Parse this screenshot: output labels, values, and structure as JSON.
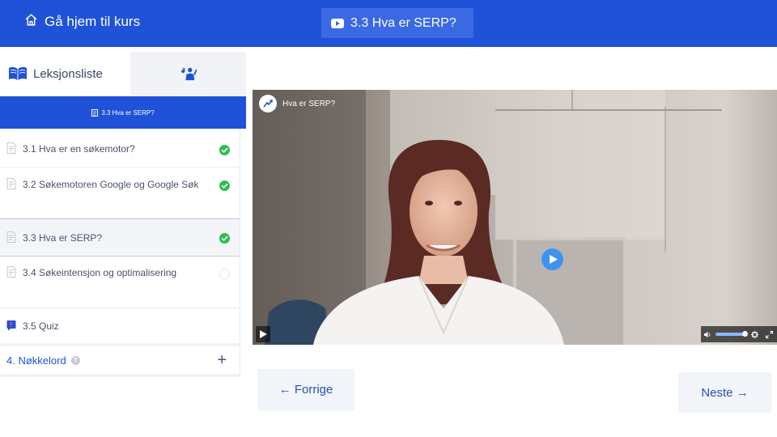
{
  "header": {
    "home_label": "Gå hjem til kurs",
    "home_icon": "home-icon",
    "current_lesson": "3.3 Hva er SERP?",
    "lesson_icon": "youtube-icon",
    "background": "#1f52d8"
  },
  "sidebar": {
    "tabs": [
      {
        "label": "Leksjonsliste",
        "icon": "book-open-icon"
      },
      {
        "label": "",
        "icon": "raised-hand-person-icon"
      }
    ],
    "current_label": "3.3 Hva er SERP?",
    "lessons": [
      {
        "title": "3.1 Hva er en søkemotor?",
        "icon": "document-icon",
        "status": "done"
      },
      {
        "title": "3.2 Søkemotoren Google og Google Søk",
        "icon": "document-icon",
        "status": "done"
      },
      {
        "title": "3.3 Hva er SERP?",
        "icon": "document-icon",
        "status": "done",
        "current": true
      },
      {
        "title": "3.4 Søkeintensjon og optimalisering",
        "icon": "document-icon",
        "status": "pending"
      },
      {
        "title": "3.5 Quiz",
        "icon": "quiz-icon",
        "status": "none"
      }
    ],
    "section": {
      "title": "4. Nøkkelord",
      "help": "?",
      "expand": "+"
    }
  },
  "video": {
    "title": "Hva er SERP?",
    "volume": 1.0
  },
  "nav": {
    "prev_label": "← Forrige",
    "next_label": "Neste →"
  },
  "colors": {
    "accent": "#1f52d8",
    "check": "#2dbd54",
    "play": "#3e93f0"
  }
}
